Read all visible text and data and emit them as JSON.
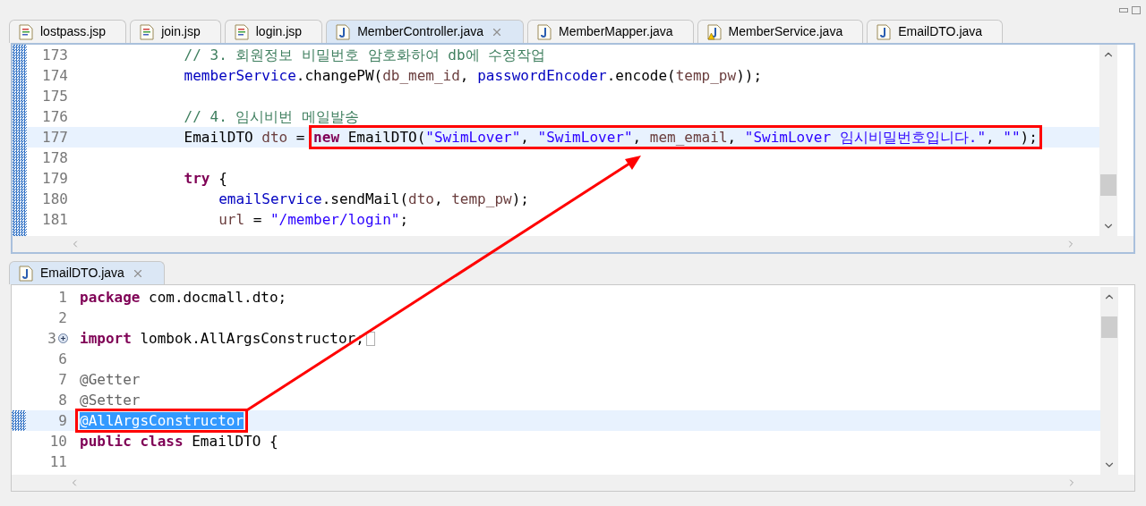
{
  "top_editor": {
    "tabs": [
      {
        "label": "lostpass.jsp",
        "kind": "jsp",
        "selected": false,
        "warning": false
      },
      {
        "label": "join.jsp",
        "kind": "jsp",
        "selected": false,
        "warning": false
      },
      {
        "label": "login.jsp",
        "kind": "jsp",
        "selected": false,
        "warning": false
      },
      {
        "label": "MemberController.java",
        "kind": "java",
        "selected": true,
        "warning": false
      },
      {
        "label": "MemberMapper.java",
        "kind": "java",
        "selected": false,
        "warning": false
      },
      {
        "label": "MemberService.java",
        "kind": "java",
        "selected": false,
        "warning": true
      },
      {
        "label": "EmailDTO.java",
        "kind": "java",
        "selected": false,
        "warning": false
      }
    ],
    "lines": [
      {
        "number": "173",
        "current": false,
        "tokens": [
          {
            "kind": "comment",
            "text": "            // 3. 회원정보 비밀번호 암호화하여 db에 수정작업"
          }
        ]
      },
      {
        "number": "174",
        "current": false,
        "tokens": [
          {
            "kind": "field",
            "text": "            memberService"
          },
          {
            "kind": "plain",
            "text": ".changePW("
          },
          {
            "kind": "local",
            "text": "db_mem_id"
          },
          {
            "kind": "plain",
            "text": ", "
          },
          {
            "kind": "field",
            "text": "passwordEncoder"
          },
          {
            "kind": "plain",
            "text": ".encode("
          },
          {
            "kind": "local",
            "text": "temp_pw"
          },
          {
            "kind": "plain",
            "text": "));"
          }
        ]
      },
      {
        "number": "175",
        "current": false
      },
      {
        "number": "176",
        "current": false,
        "tokens": [
          {
            "kind": "comment",
            "text": "            // 4. 임시비번 메일발송"
          }
        ]
      },
      {
        "number": "177",
        "current": true,
        "tokens": [
          {
            "kind": "plain",
            "text": "            EmailDTO "
          },
          {
            "kind": "local",
            "text": "dto"
          },
          {
            "kind": "plain",
            "text": " = "
          }
        ],
        "box": [
          {
            "kind": "keyword",
            "text": "new"
          },
          {
            "kind": "plain",
            "text": " EmailDTO("
          },
          {
            "kind": "string",
            "text": "\"SwimLover\""
          },
          {
            "kind": "plain",
            "text": ", "
          },
          {
            "kind": "string",
            "text": "\"SwimLover\""
          },
          {
            "kind": "plain",
            "text": ", "
          },
          {
            "kind": "local",
            "text": "mem_email"
          },
          {
            "kind": "plain",
            "text": ", "
          },
          {
            "kind": "string",
            "text": "\"SwimLover 임시비밀번호입니다.\""
          },
          {
            "kind": "plain",
            "text": ", "
          },
          {
            "kind": "string",
            "text": "\"\""
          },
          {
            "kind": "plain",
            "text": ");"
          }
        ]
      },
      {
        "number": "178",
        "current": false
      },
      {
        "number": "179",
        "current": false,
        "tokens": [
          {
            "kind": "keyword",
            "text": "            try"
          },
          {
            "kind": "plain",
            "text": " {"
          }
        ]
      },
      {
        "number": "180",
        "current": false,
        "tokens": [
          {
            "kind": "field",
            "text": "                emailService"
          },
          {
            "kind": "plain",
            "text": ".sendMail("
          },
          {
            "kind": "local",
            "text": "dto"
          },
          {
            "kind": "plain",
            "text": ", "
          },
          {
            "kind": "local",
            "text": "temp_pw"
          },
          {
            "kind": "plain",
            "text": ");"
          }
        ]
      },
      {
        "number": "181",
        "current": false,
        "tokens": [
          {
            "kind": "local",
            "text": "                url"
          },
          {
            "kind": "plain",
            "text": " = "
          },
          {
            "kind": "string",
            "text": "\"/member/login\""
          },
          {
            "kind": "plain",
            "text": ";"
          }
        ]
      }
    ]
  },
  "bottom_editor": {
    "tabs": [
      {
        "label": "EmailDTO.java",
        "kind": "java",
        "selected": true,
        "warning": false
      }
    ],
    "lines": [
      {
        "number": "1",
        "current": false,
        "tokens": [
          {
            "kind": "keyword",
            "text": "package"
          },
          {
            "kind": "plain",
            "text": " com.docmall.dto;"
          }
        ]
      },
      {
        "number": "2",
        "current": false
      },
      {
        "number": "3",
        "current": false,
        "folded": true,
        "tokens": [
          {
            "kind": "keyword",
            "text": "import"
          },
          {
            "kind": "plain",
            "text": " lombok.AllArgsConstructor;"
          }
        ]
      },
      {
        "number": "6",
        "current": false
      },
      {
        "number": "7",
        "current": false,
        "tokens": [
          {
            "kind": "annotation",
            "text": "@Getter"
          }
        ]
      },
      {
        "number": "8",
        "current": false,
        "tokens": [
          {
            "kind": "annotation",
            "text": "@Setter"
          }
        ]
      },
      {
        "number": "9",
        "current": true,
        "box": [
          {
            "text": "@AllArgsConstructor",
            "selected": true
          }
        ]
      },
      {
        "number": "10",
        "current": false,
        "tokens": [
          {
            "kind": "keyword",
            "text": "public"
          },
          {
            "kind": "keyword",
            "text": " class"
          },
          {
            "kind": "plain",
            "text": " EmailDTO {"
          }
        ]
      },
      {
        "number": "11",
        "current": false
      }
    ]
  }
}
